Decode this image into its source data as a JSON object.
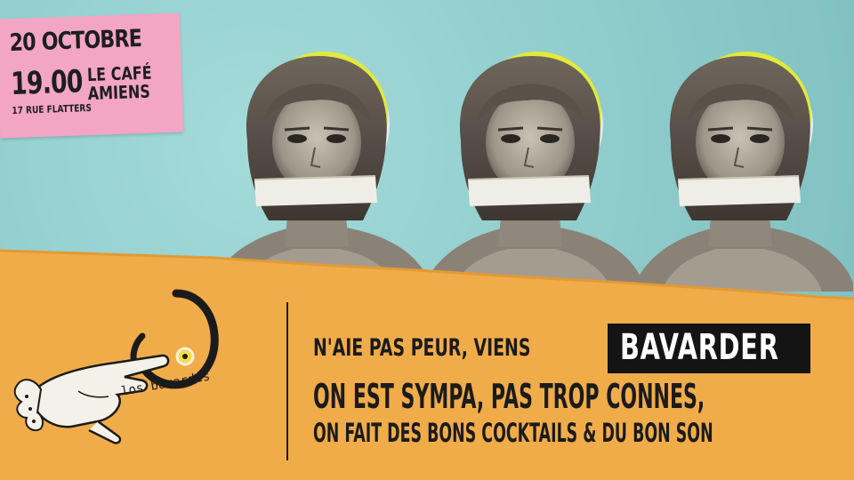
{
  "event": {
    "date": "20 OCTOBRE",
    "time": "19.00",
    "venue_line1": "LE CAFÉ",
    "venue_line2": "AMIENS",
    "address": "17 RUE FLATTERS"
  },
  "tagline": {
    "line1_prefix": "N'AIE PAS PEUR, VIENS",
    "line1_highlight": "BAVARDER",
    "line2": "ON EST SYMPA, PAS TROP CONNES,",
    "line3": "ON FAIT DES BONS COCKTAILS & DU BON SON"
  },
  "logo": {
    "name": "los bavardes"
  },
  "colors": {
    "sky": "#8fcfcf",
    "paper_orange": "#f1ac4a",
    "ticket_pink": "#f3a6c4",
    "halo_yellow": "#e3e93a",
    "ink": "#1b1b1b"
  },
  "icons": [
    "pointing-hand-icon",
    "los-bavardes-logo-icon"
  ]
}
